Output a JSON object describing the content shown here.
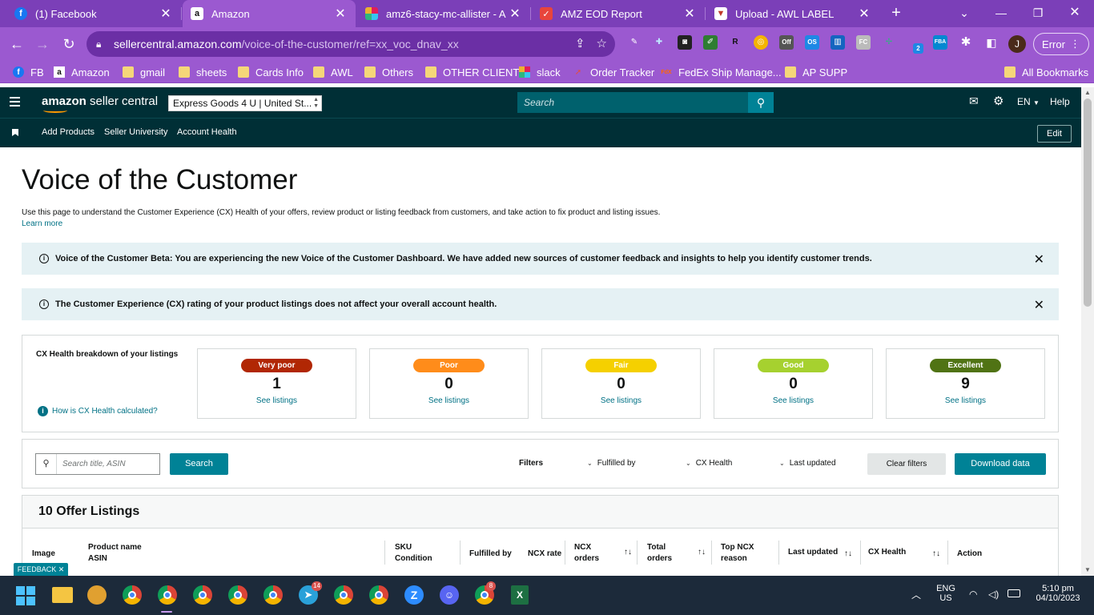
{
  "browser": {
    "tabs": [
      {
        "title": "(1) Facebook",
        "icon": "facebook-icon",
        "color": "#1877f2",
        "glyph": "f"
      },
      {
        "title": "Amazon",
        "icon": "amazon-icon",
        "color": "#111111",
        "glyph": "a",
        "active": true
      },
      {
        "title": "amz6-stacy-mc-allister - Am",
        "icon": "slack-icon",
        "color": "#e01e5a",
        "glyph": "#"
      },
      {
        "title": "AMZ EOD Report",
        "icon": "sheets-report-icon",
        "color": "#e8453c",
        "glyph": "✓"
      },
      {
        "title": "Upload - AWL LABEL",
        "icon": "awl-icon",
        "color": "#c0392b",
        "glyph": "▼"
      }
    ],
    "url_host": "sellercentral.amazon.com",
    "url_path": "/voice-of-the-customer/ref=xx_voc_dnav_xx",
    "error_label": "Error",
    "profile_initial": "J",
    "bookmarks": [
      {
        "label": "FB",
        "icon": "facebook-icon"
      },
      {
        "label": "Amazon",
        "icon": "amazon-icon"
      },
      {
        "label": "gmail",
        "icon": "folder-icon"
      },
      {
        "label": "sheets",
        "icon": "folder-icon"
      },
      {
        "label": "Cards Info",
        "icon": "folder-icon"
      },
      {
        "label": "AWL",
        "icon": "folder-icon"
      },
      {
        "label": "Others",
        "icon": "folder-icon"
      },
      {
        "label": "OTHER CLIENT",
        "icon": "folder-icon"
      },
      {
        "label": "slack",
        "icon": "slack-icon"
      },
      {
        "label": "Order Tracker",
        "icon": "tracker-icon"
      },
      {
        "label": "FedEx Ship Manage...",
        "icon": "fedex-icon"
      },
      {
        "label": "AP SUPP",
        "icon": "folder-icon"
      },
      {
        "label": "All Bookmarks",
        "icon": "folder-icon"
      }
    ]
  },
  "header": {
    "logo_bold": "amazon",
    "logo_rest": " seller central",
    "store": "Express Goods 4 U | United St...",
    "search_placeholder": "Search",
    "language": "EN",
    "help": "Help"
  },
  "subnav": {
    "items": [
      "Add Products",
      "Seller University",
      "Account Health"
    ],
    "edit": "Edit"
  },
  "page": {
    "title": "Voice of the Customer",
    "description": "Use this page to understand the Customer Experience (CX) Health of your offers, review product or listing feedback from customers, and take action to fix product and listing issues.",
    "learn_more": "Learn more",
    "banners": [
      "Voice of the Customer Beta: You are experiencing the new Voice of the Customer Dashboard. We have added new sources of customer feedback and insights to help you identify customer trends.",
      "The Customer Experience (CX) rating of your product listings does not affect your overall account health."
    ]
  },
  "cx": {
    "label": "CX Health breakdown of your listings",
    "how_link": "How is CX Health calculated?",
    "see_listings": "See listings",
    "cards": [
      {
        "label": "Very poor",
        "count": "1",
        "color": "#b12704",
        "text_color": "#ffffff"
      },
      {
        "label": "Poor",
        "count": "0",
        "color": "#ff8c1a",
        "text_color": "#ffffff"
      },
      {
        "label": "Fair",
        "count": "0",
        "color": "#f5d000",
        "text_color": "#ffffff"
      },
      {
        "label": "Good",
        "count": "0",
        "color": "#a6d12f",
        "text_color": "#ffffff"
      },
      {
        "label": "Excellent",
        "count": "9",
        "color": "#507314",
        "text_color": "#ffffff"
      }
    ]
  },
  "filters": {
    "search_placeholder": "Search title, ASIN",
    "search_button": "Search",
    "label": "Filters",
    "dropdowns": [
      "Fulfilled by",
      "CX Health",
      "Last updated"
    ],
    "clear": "Clear filters",
    "download": "Download data"
  },
  "listings": {
    "heading": "10 Offer Listings",
    "columns": [
      {
        "line1": "Image",
        "line2": ""
      },
      {
        "line1": "Product name",
        "line2": "ASIN"
      },
      {
        "line1": "SKU",
        "line2": "Condition"
      },
      {
        "line1": "Fulfilled by",
        "line2": ""
      },
      {
        "line1": "NCX rate",
        "line2": ""
      },
      {
        "line1": "NCX",
        "line2": "orders"
      },
      {
        "line1": "Total",
        "line2": "orders"
      },
      {
        "line1": "Top NCX",
        "line2": "reason"
      },
      {
        "line1": "Last updated",
        "line2": ""
      },
      {
        "line1": "CX Health",
        "line2": ""
      },
      {
        "line1": "Action",
        "line2": ""
      }
    ]
  },
  "feedback": "FEEDBACK",
  "taskbar": {
    "language": "ENG",
    "region": "US",
    "time": "5:10 pm",
    "date": "04/10/2023",
    "badge_telegram": "14",
    "badge_chrome": "8"
  }
}
